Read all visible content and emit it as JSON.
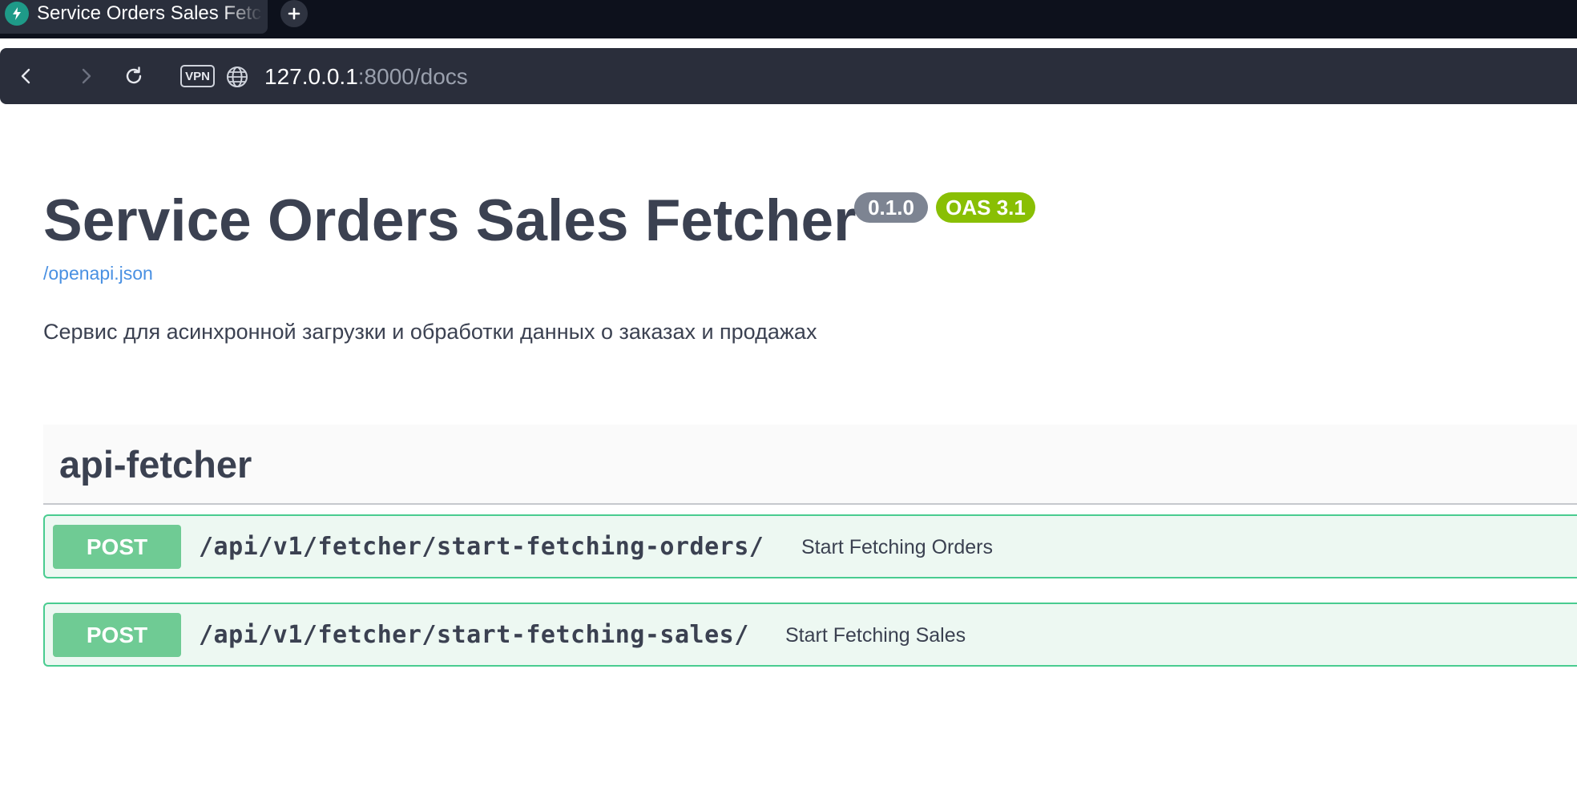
{
  "browser": {
    "tab_title": "Service Orders Sales Fetcher",
    "address": {
      "host": "127.0.0.1",
      "rest": ":8000/docs"
    },
    "vpn_label": "VPN"
  },
  "docs": {
    "title": "Service Orders Sales Fetcher",
    "version": "0.1.0",
    "oas_version": "OAS 3.1",
    "spec_link": "/openapi.json",
    "description": "Сервис для асинхронной загрузки и обработки данных о заказах и продажах",
    "tag": "api-fetcher",
    "operations": [
      {
        "method": "POST",
        "path": "/api/v1/fetcher/start-fetching-orders/",
        "summary": "Start Fetching Orders"
      },
      {
        "method": "POST",
        "path": "/api/v1/fetcher/start-fetching-sales/",
        "summary": "Start Fetching Sales"
      }
    ]
  },
  "colors": {
    "post_method": "#49cc90",
    "oas_badge": "#89bf04",
    "version_badge": "#7d8492",
    "link": "#4990e2"
  }
}
